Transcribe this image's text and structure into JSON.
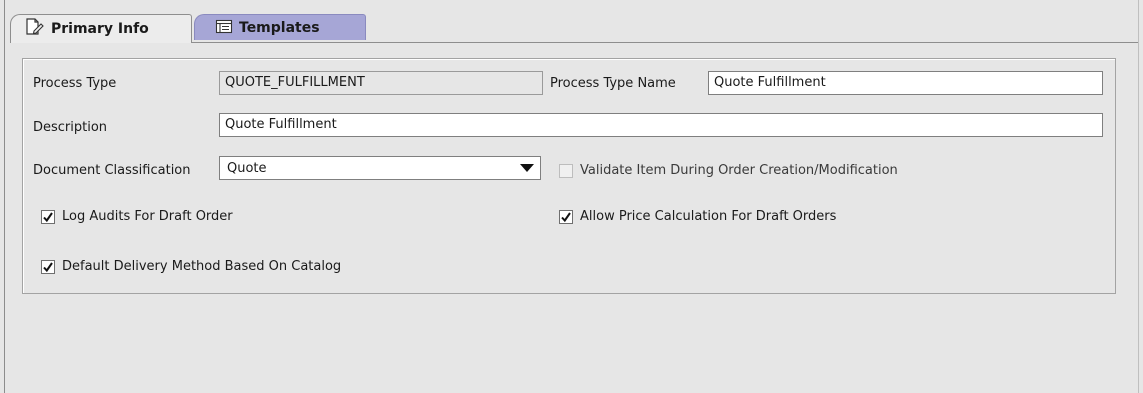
{
  "tabs": {
    "primary_label": "Primary Info",
    "templates_label": "Templates"
  },
  "form": {
    "process_type_label": "Process Type",
    "process_type_value": "QUOTE_FULFILLMENT",
    "process_type_name_label": "Process Type Name",
    "process_type_name_value": "Quote Fulfillment",
    "description_label": "Description",
    "description_value": "Quote Fulfillment",
    "document_classification_label": "Document Classification",
    "document_classification_value": "Quote",
    "validate_item_label": "Validate Item During Order Creation/Modification",
    "validate_item_checked": false,
    "log_audits_label": "Log Audits For Draft Order",
    "log_audits_checked": true,
    "allow_price_label": "Allow Price Calculation For Draft Orders",
    "allow_price_checked": true,
    "default_delivery_label": "Default Delivery Method Based On Catalog",
    "default_delivery_checked": true
  },
  "colors": {
    "active_tab": "#ececec",
    "inactive_tab": "#a6a6d6",
    "panel_bg": "#e6e6e6"
  },
  "icons": {
    "primary_tab": "document-edit-icon",
    "templates_tab": "template-list-icon",
    "dropdown": "dropdown-arrow-icon",
    "check": "checkmark-icon"
  }
}
